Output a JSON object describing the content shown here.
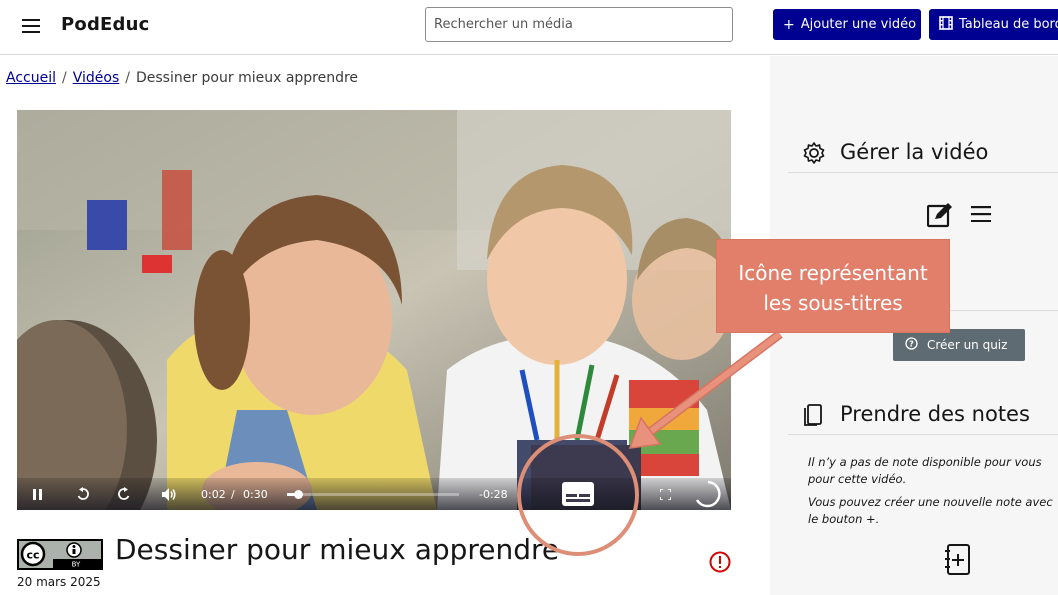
{
  "header": {
    "brand": "PodEduc",
    "search_placeholder": "Rechercher un média",
    "add_video_label": "Ajouter une vidéo",
    "dashboard_label": "Tableau de bord"
  },
  "breadcrumb": {
    "home": "Accueil",
    "videos": "Vidéos",
    "current": "Dessiner pour mieux apprendre"
  },
  "player": {
    "current_time": "0:02",
    "separator": "/",
    "duration": "0:30",
    "remaining": "-0:28",
    "progress_fraction": 0.067
  },
  "video": {
    "title": "Dessiner pour mieux apprendre",
    "date": "20 mars 2025",
    "license": "CC BY"
  },
  "sidebar": {
    "manage_title": "Gérer la vidéo",
    "quiz_label": "Créer un quiz",
    "notes_title": "Prendre des notes",
    "notes_empty_1": "Il n’y a pas de note disponible pour vous pour cette vidéo.",
    "notes_empty_2": "Vous pouvez créer une nouvelle note avec le bouton +."
  },
  "annotation": {
    "line1": "Icône représentant",
    "line2": "les sous-titres"
  },
  "colors": {
    "primary_blue": "#000091",
    "callout": "#e27f6b",
    "sidebar_bg": "#f6f6f6"
  }
}
